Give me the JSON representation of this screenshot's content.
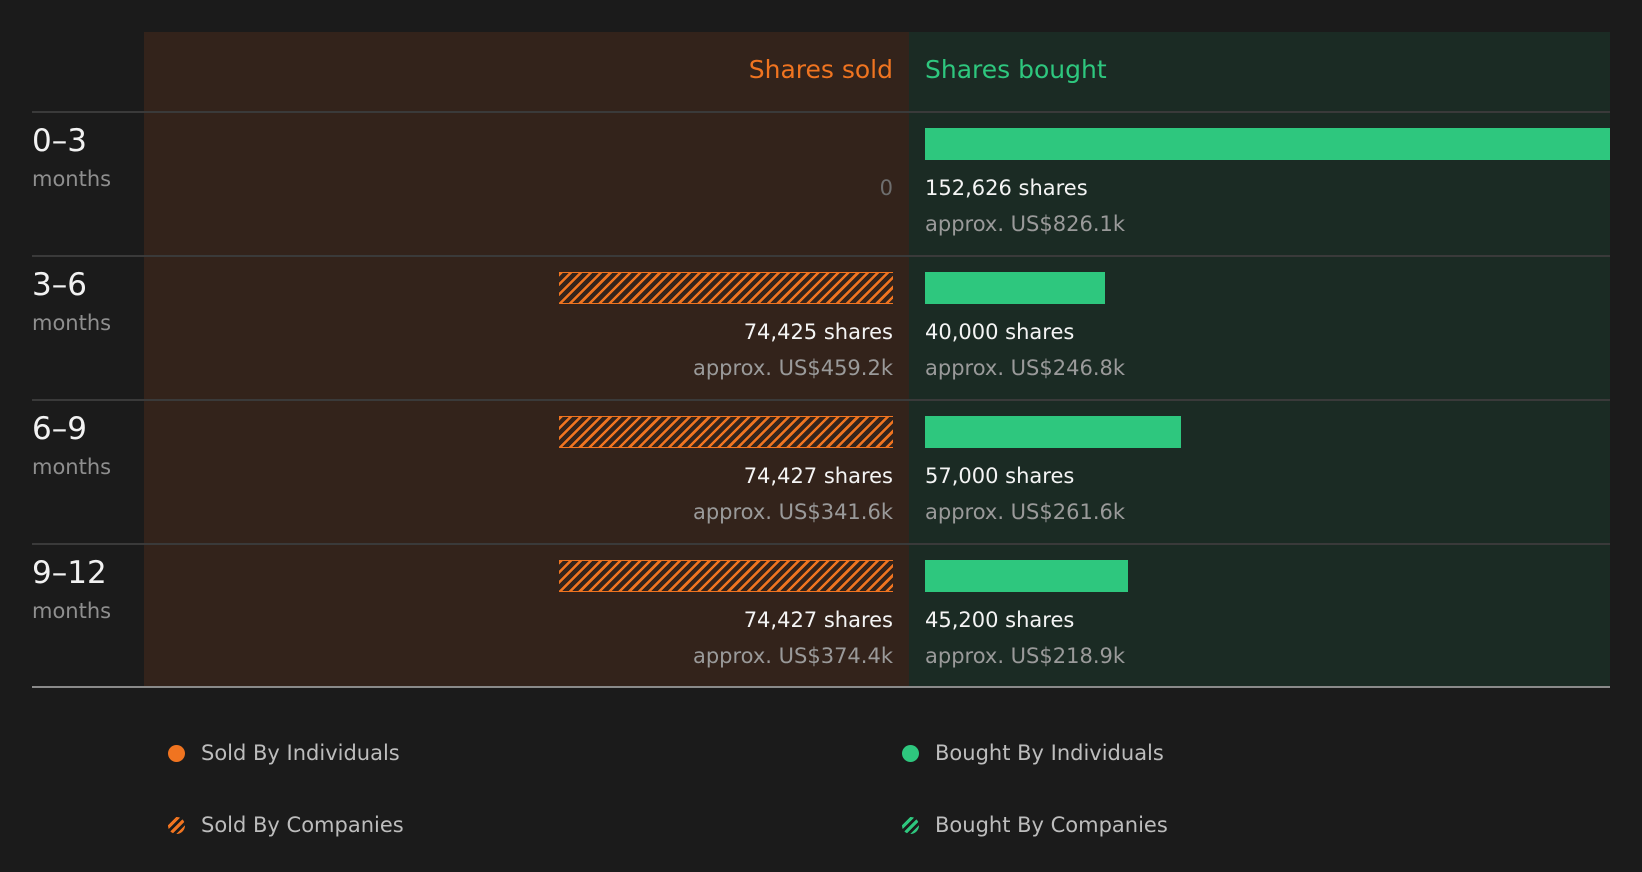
{
  "chart_data": {
    "type": "bar",
    "headers": {
      "sold": "Shares sold",
      "bought": "Shares bought"
    },
    "categories": [
      "0–3",
      "3–6",
      "6–9",
      "9–12"
    ],
    "category_unit": "months",
    "series": [
      {
        "name": "Shares sold",
        "values": [
          0,
          74425,
          74427,
          74427
        ]
      },
      {
        "name": "Shares bought",
        "values": [
          152626,
          40000,
          57000,
          45200
        ]
      }
    ],
    "rows": [
      {
        "range": "0–3",
        "unit": "months",
        "sold": {
          "value": 0,
          "shares_label": "0",
          "approx_label": "",
          "by": "companies"
        },
        "bought": {
          "value": 152626,
          "shares_label": "152,626 shares",
          "approx_label": "approx. US$826.1k",
          "by": "individuals"
        }
      },
      {
        "range": "3–6",
        "unit": "months",
        "sold": {
          "value": 74425,
          "shares_label": "74,425 shares",
          "approx_label": "approx. US$459.2k",
          "by": "companies"
        },
        "bought": {
          "value": 40000,
          "shares_label": "40,000 shares",
          "approx_label": "approx. US$246.8k",
          "by": "individuals"
        }
      },
      {
        "range": "6–9",
        "unit": "months",
        "sold": {
          "value": 74427,
          "shares_label": "74,427 shares",
          "approx_label": "approx. US$341.6k",
          "by": "companies"
        },
        "bought": {
          "value": 57000,
          "shares_label": "57,000 shares",
          "approx_label": "approx. US$261.6k",
          "by": "individuals"
        }
      },
      {
        "range": "9–12",
        "unit": "months",
        "sold": {
          "value": 74427,
          "shares_label": "74,427 shares",
          "approx_label": "approx. US$374.4k",
          "by": "companies"
        },
        "bought": {
          "value": 45200,
          "shares_label": "45,200 shares",
          "approx_label": "approx. US$218.9k",
          "by": "individuals"
        }
      }
    ],
    "legend": {
      "sold_individuals": "Sold By Individuals",
      "sold_companies": "Sold By Companies",
      "bought_individuals": "Bought By Individuals",
      "bought_companies": "Bought By Companies"
    },
    "colors": {
      "sold": "#f07420",
      "bought": "#2ec77e",
      "sold_panel": "#33231b",
      "bought_panel": "#1b2b24"
    }
  }
}
